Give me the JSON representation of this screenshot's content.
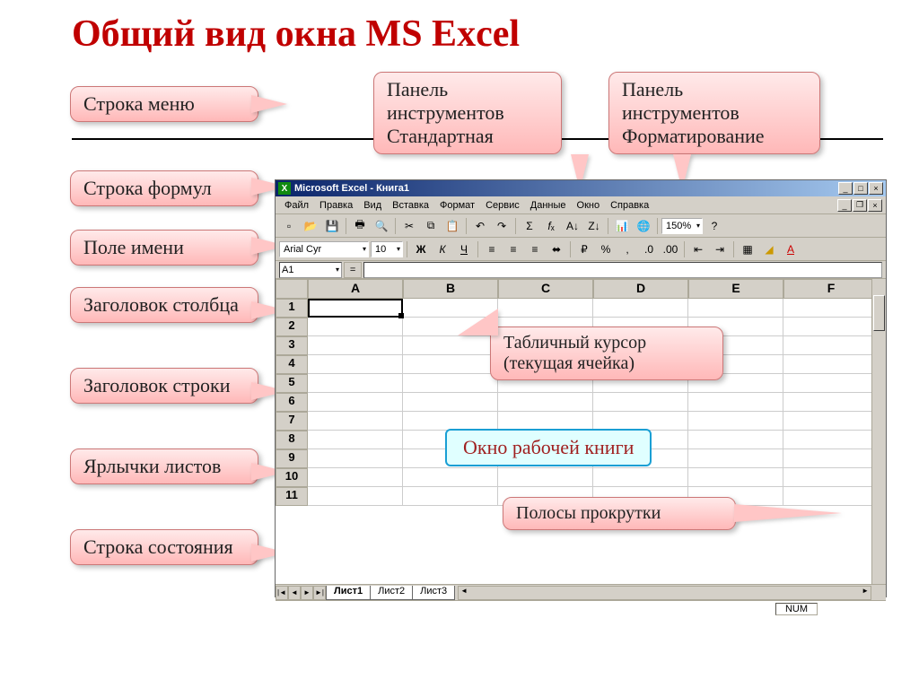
{
  "title": "Общий вид окна MS Excel",
  "callouts": {
    "menu_row": "Строка меню",
    "formula_bar": "Строка формул",
    "name_box": "Поле имени",
    "col_header": "Заголовок столбца",
    "row_header": "Заголовок строки",
    "sheet_tabs": "Ярлычки листов",
    "status_bar": "Строка состояния",
    "toolbar_standard_l1": "Панель",
    "toolbar_standard_l2": "инструментов",
    "toolbar_standard_l3": "Стандартная",
    "toolbar_format_l1": "Панель",
    "toolbar_format_l2": "инструментов",
    "toolbar_format_l3": "Форматирование",
    "cell_cursor_l1": "Табличный курсор",
    "cell_cursor_l2": "(текущая ячейка)",
    "scrollbars": "Полосы прокрутки",
    "workbook_window": "Окно рабочей книги"
  },
  "excel": {
    "titlebar": "Microsoft Excel - Книга1",
    "menu": [
      "Файл",
      "Правка",
      "Вид",
      "Вставка",
      "Формат",
      "Сервис",
      "Данные",
      "Окно",
      "Справка"
    ],
    "font_name": "Arial Cyr",
    "font_size": "10",
    "zoom": "150%",
    "name_box": "A1",
    "columns": [
      "A",
      "B",
      "C",
      "D",
      "E",
      "F"
    ],
    "rows": [
      "1",
      "2",
      "3",
      "4",
      "5",
      "6",
      "7",
      "8",
      "9",
      "10",
      "11"
    ],
    "sheets": [
      "Лист1",
      "Лист2",
      "Лист3"
    ],
    "status_num": "NUM"
  }
}
